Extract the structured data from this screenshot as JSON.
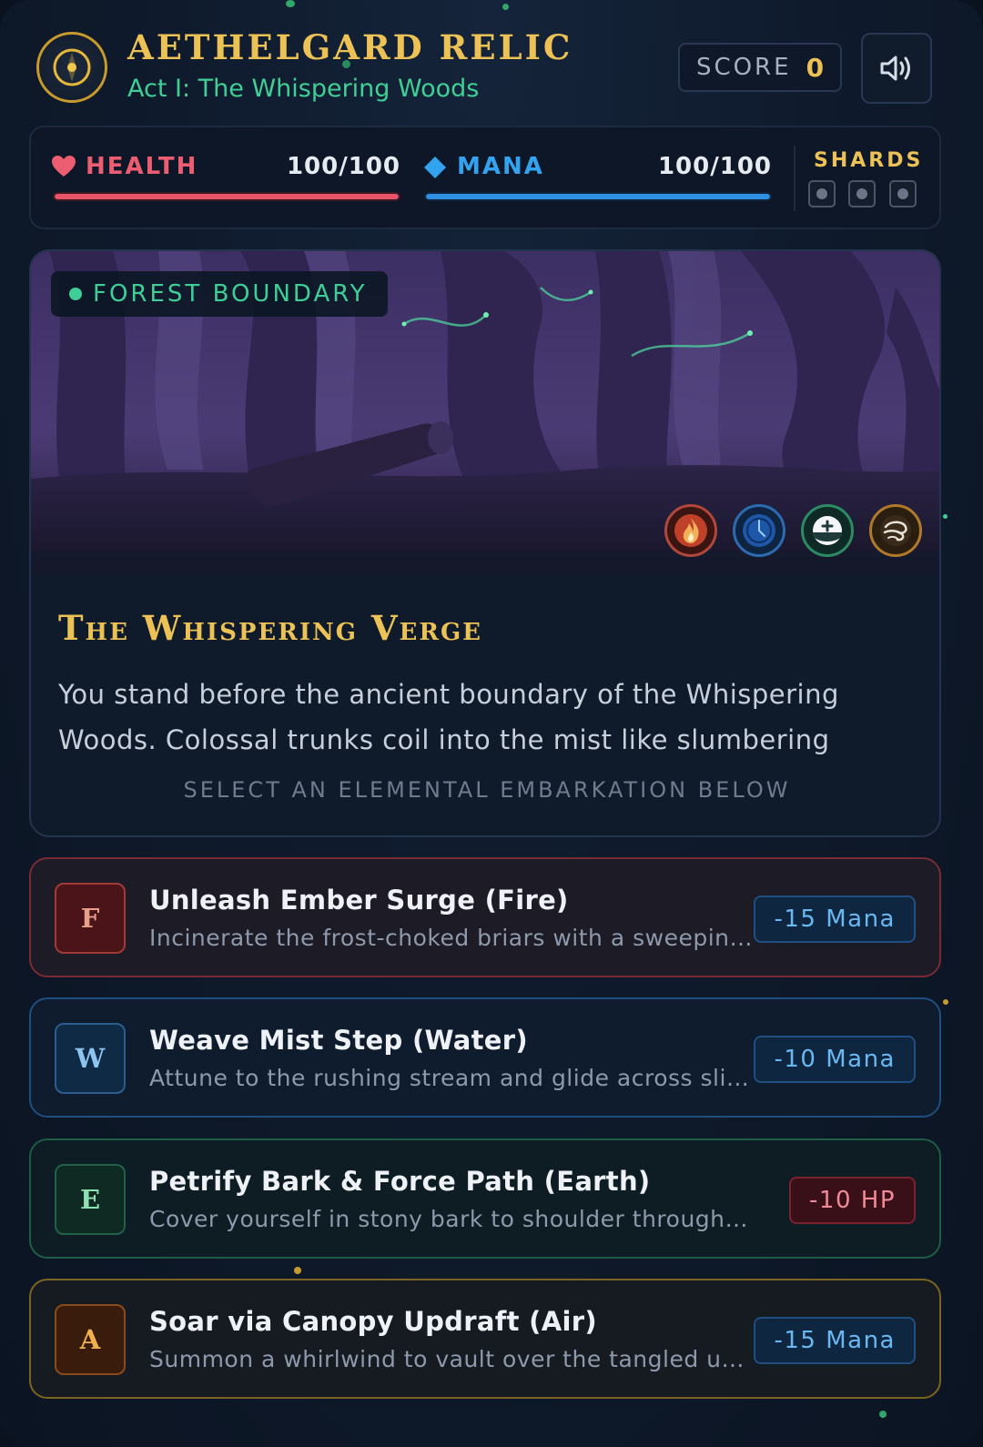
{
  "header": {
    "title": "AETHELGARD RELIC",
    "subtitle": "Act I: The Whispering Woods",
    "score_label": "SCORE",
    "score_value": "0",
    "emblem_icon": "compass-emblem-icon",
    "sound_icon": "speaker-icon"
  },
  "stats": {
    "health": {
      "label": "HEALTH",
      "value": "100/100",
      "fraction": 1.0,
      "color": "#e8536a",
      "icon": "heart-icon"
    },
    "mana": {
      "label": "MANA",
      "value": "100/100",
      "fraction": 1.0,
      "color": "#2f8fe0",
      "icon": "diamond-icon"
    },
    "shards": {
      "label": "SHARDS",
      "collected": 0,
      "total": 3
    }
  },
  "scene": {
    "location": "FOREST BOUNDARY",
    "title": "The Whispering Verge",
    "description": "You stand before the ancient boundary of the Whispering Woods. Colossal trunks coil into the mist like slumbering",
    "prompt": "SELECT AN ELEMENTAL EMBARKATION BELOW",
    "element_icons": [
      "fire-icon",
      "water-icon",
      "earth-icon",
      "air-icon"
    ]
  },
  "choices": [
    {
      "key": "F",
      "title": "Unleash Ember Surge (Fire)",
      "description": "Incinerate the frost-choked briars with a sweeping blaze of ember fire",
      "cost": "-15 Mana",
      "border": "#7a2a33",
      "bg": "#1c1b26",
      "key_color": "#e8a08a",
      "key_bg": "#4a1418",
      "key_border": "#a23a3a",
      "cost_kind": "mana"
    },
    {
      "key": "W",
      "title": "Weave Mist Step (Water)",
      "description": "Attune to the rushing stream and glide across slippery stones",
      "cost": "-10 Mana",
      "border": "#1f4f80",
      "bg": "#0f1c2e",
      "key_color": "#8fc3f0",
      "key_bg": "#0f2a44",
      "key_border": "#2b5e8e",
      "cost_kind": "mana"
    },
    {
      "key": "E",
      "title": "Petrify Bark & Force Path (Earth)",
      "description": "Cover yourself in stony bark to shoulder through the brambles",
      "cost": "-10 HP",
      "border": "#1f5c46",
      "bg": "#0e1d24",
      "key_color": "#8fe0b4",
      "key_bg": "#0e2a22",
      "key_border": "#23604a",
      "cost_kind": "hp"
    },
    {
      "key": "A",
      "title": "Soar via Canopy Updraft (Air)",
      "description": "Summon a whirlwind to vault over the tangled undergrowth",
      "cost": "-15 Mana",
      "border": "#7a6420",
      "bg": "#161b22",
      "key_color": "#f0b050",
      "key_bg": "#3a1c0c",
      "key_border": "#8a4a1a",
      "cost_kind": "mana"
    }
  ]
}
